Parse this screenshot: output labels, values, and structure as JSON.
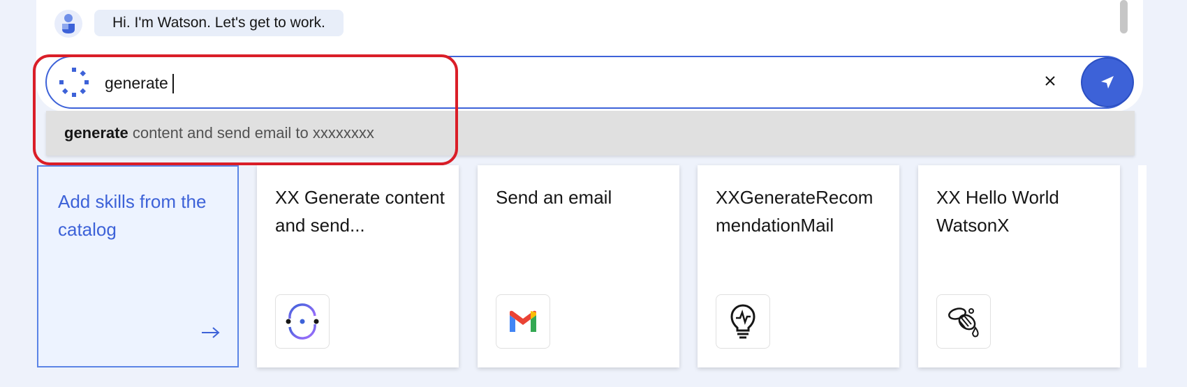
{
  "chat": {
    "greeting": "Hi. I'm Watson. Let's get to work."
  },
  "input": {
    "value": "generate",
    "clear_icon": "close-icon",
    "send_icon": "send-icon",
    "accent_color": "#3d62d8"
  },
  "suggestion": {
    "match": "generate",
    "rest": " content and send email to xxxxxxxx"
  },
  "skills": {
    "add_label": "Add skills from the catalog",
    "add_icon": "arrow-right-icon",
    "cards": [
      {
        "title": "XX Generate content and send...",
        "icon": "sync-icon"
      },
      {
        "title": "Send an email",
        "icon": "gmail-icon"
      },
      {
        "title": "XXGenerateRecommendationMail",
        "icon": "lightbulb-icon"
      },
      {
        "title": "XX Hello World WatsonX",
        "icon": "bee-icon"
      }
    ]
  }
}
